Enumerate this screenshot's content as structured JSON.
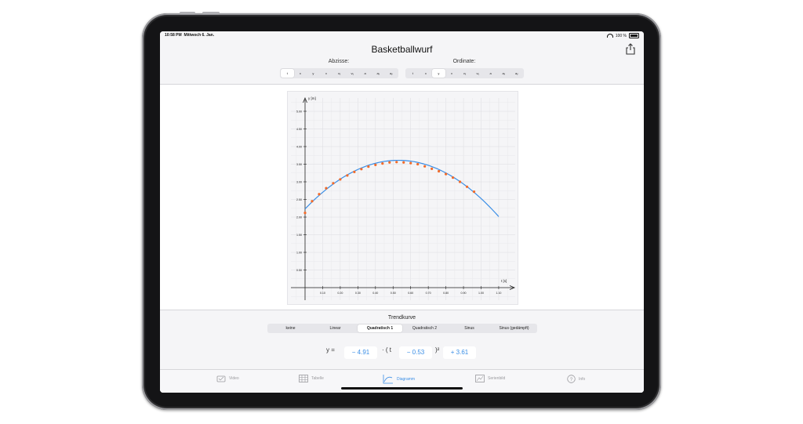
{
  "status_bar": {
    "time": "10:58 PM",
    "date": "Mittwoch 6. Jan.",
    "battery": "100 %"
  },
  "header": {
    "title": "Basketballwurf",
    "abscissa_label": "Abzisse:",
    "ordinate_label": "Ordinate:",
    "abscissa_options": [
      "t",
      "x",
      "y",
      "v",
      "vₓ",
      "vᵧ",
      "a",
      "aₓ",
      "aᵧ"
    ],
    "abscissa_selected": "t",
    "ordinate_options": [
      "t",
      "x",
      "y",
      "v",
      "vₓ",
      "vᵧ",
      "a",
      "aₓ",
      "aᵧ"
    ],
    "ordinate_selected": "y"
  },
  "chart_data": {
    "type": "scatter",
    "xlabel": "t [s]",
    "ylabel": "y [m]",
    "xlim": [
      0,
      1.1
    ],
    "ylim": [
      0,
      5.0
    ],
    "x_ticks": [
      "0.10",
      "0.20",
      "0.30",
      "0.40",
      "0.50",
      "0.60",
      "0.70",
      "0.80",
      "0.90",
      "1.00",
      "1.10"
    ],
    "y_ticks": [
      "0.50",
      "1.00",
      "1.50",
      "2.00",
      "2.50",
      "3.00",
      "3.50",
      "4.00",
      "4.50",
      "5.00"
    ],
    "grid": true,
    "series": [
      {
        "type": "scatter",
        "color": "#f26b2a",
        "x": [
          0.0,
          0.04,
          0.08,
          0.12,
          0.16,
          0.2,
          0.24,
          0.28,
          0.32,
          0.36,
          0.4,
          0.44,
          0.48,
          0.52,
          0.56,
          0.6,
          0.64,
          0.68,
          0.72,
          0.76,
          0.8,
          0.84,
          0.88,
          0.92,
          0.96
        ],
        "y": [
          2.12,
          2.45,
          2.65,
          2.82,
          2.96,
          3.07,
          3.18,
          3.28,
          3.36,
          3.43,
          3.48,
          3.52,
          3.55,
          3.56,
          3.55,
          3.53,
          3.5,
          3.44,
          3.37,
          3.3,
          3.22,
          3.12,
          3.0,
          2.86,
          2.72
        ]
      },
      {
        "type": "line",
        "color": "#3a8ee6",
        "fit": {
          "a": -4.91,
          "b": 0.53,
          "c": 3.61
        },
        "x_range": [
          0.0,
          1.1
        ]
      }
    ]
  },
  "trend": {
    "label": "Trendkurve",
    "options": [
      "keine",
      "Linear",
      "Quadratisch 1",
      "Quadratisch 2",
      "Sinus",
      "Sinus (gedämpft)"
    ],
    "selected": "Quadratisch 1",
    "equation": {
      "prefix": "y =",
      "a": "− 4.91",
      "mid": "· ( t",
      "b": "− 0.53",
      "suffix": ")²",
      "c": "+ 3.61"
    }
  },
  "tabs": [
    {
      "label": "Video",
      "icon": "video-icon",
      "active": false
    },
    {
      "label": "Tabelle",
      "icon": "table-icon",
      "active": false
    },
    {
      "label": "Diagramm",
      "icon": "chart-icon",
      "active": true
    },
    {
      "label": "Serienbild",
      "icon": "series-image-icon",
      "active": false
    },
    {
      "label": "Info",
      "icon": "info-icon",
      "active": false
    }
  ]
}
